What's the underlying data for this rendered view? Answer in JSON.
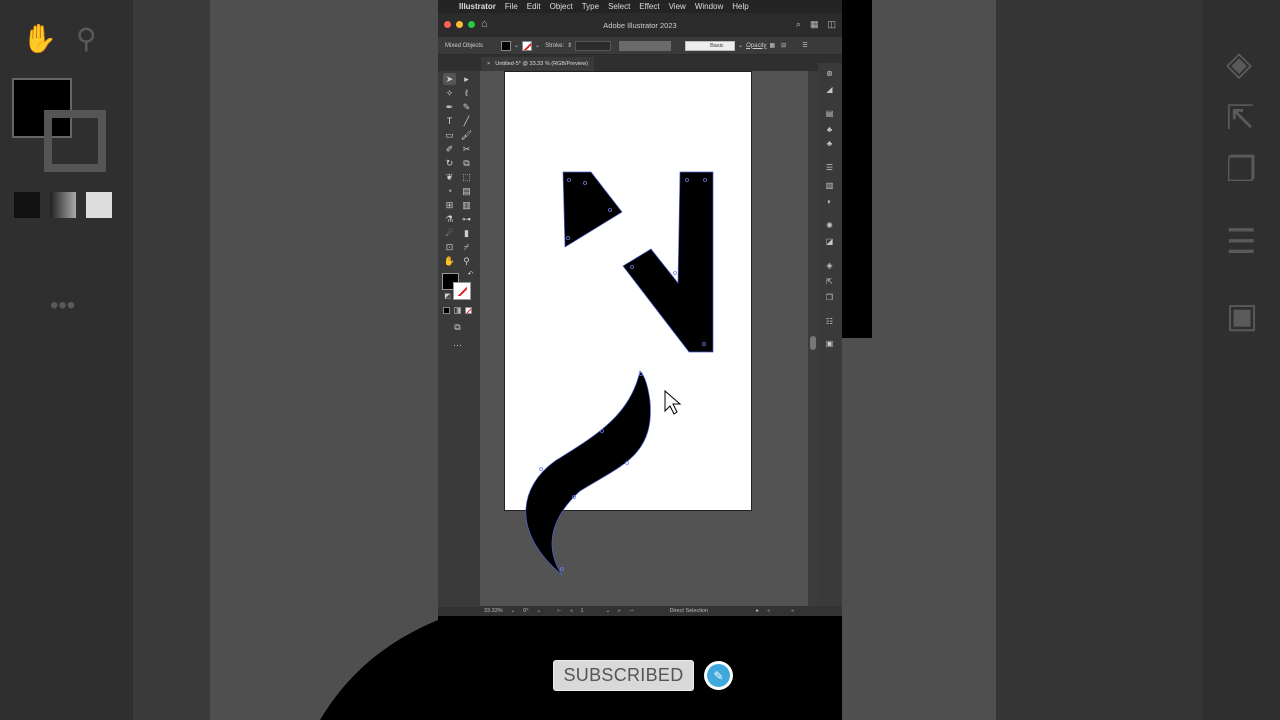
{
  "menubar": {
    "apple": "",
    "app_name": "Illustrator",
    "items": [
      "File",
      "Edit",
      "Object",
      "Type",
      "Select",
      "Effect",
      "View",
      "Window",
      "Help"
    ]
  },
  "titlebar": {
    "title": "Adobe Illustrator 2023"
  },
  "controlbar": {
    "selection_label": "Mixed Objects",
    "stroke_label": "Stroke:",
    "brush_label": "Basic",
    "opacity_label": "Opacity"
  },
  "document_tab": {
    "close": "×",
    "label": "Untitled-5* @ 33.33 % (RGB/Preview)"
  },
  "statusbar": {
    "zoom": "33.33%",
    "rotation": "0°",
    "artboard": "1",
    "tool": "Direct Selection"
  },
  "overlay": {
    "subscribed_label": "SUBSCRIBED"
  },
  "colors": {
    "fill": "#000000",
    "stroke_none_slash": "#dd2222",
    "anchor": "#4a5fd0",
    "channel_accent": "#3fa9de"
  },
  "icons": [
    "apple-icon",
    "home-icon",
    "search-icon",
    "arrange-icon",
    "panel-icon",
    "selection-tool-icon",
    "direct-selection-tool-icon",
    "pen-tool-icon",
    "type-tool-icon",
    "hand-tool-icon",
    "zoom-tool-icon",
    "layers-icon"
  ]
}
